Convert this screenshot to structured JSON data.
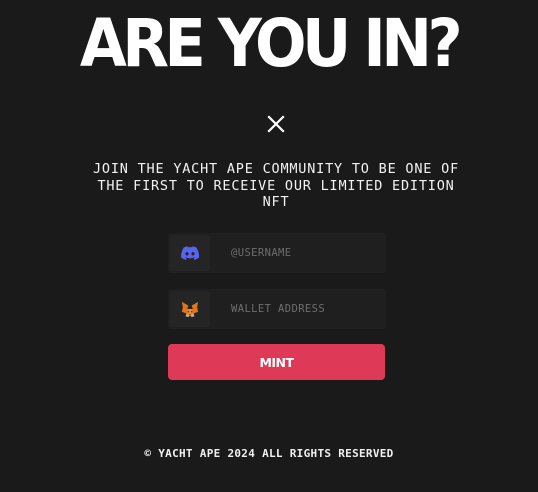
{
  "hero": {
    "title": "ARE YOU IN?"
  },
  "modal": {
    "close_icon": "close-icon",
    "tagline": "JOIN THE YACHT APE COMMUNITY TO BE ONE OF THE FIRST TO RECEIVE OUR LIMITED EDITION NFT"
  },
  "form": {
    "username": {
      "icon": "discord-icon",
      "placeholder": "@USERNAME",
      "value": ""
    },
    "wallet": {
      "icon": "metamask-fox-icon",
      "placeholder": "WALLET ADDRESS",
      "value": ""
    },
    "mint_label": "MINT"
  },
  "footer": {
    "copyright": "© YACHT APE 2024 ALL RIGHTS RESERVED"
  },
  "colors": {
    "background": "#1a1a1a",
    "accent": "#de3a58",
    "discord": "#5865f2",
    "metamask": "#e2761b"
  }
}
